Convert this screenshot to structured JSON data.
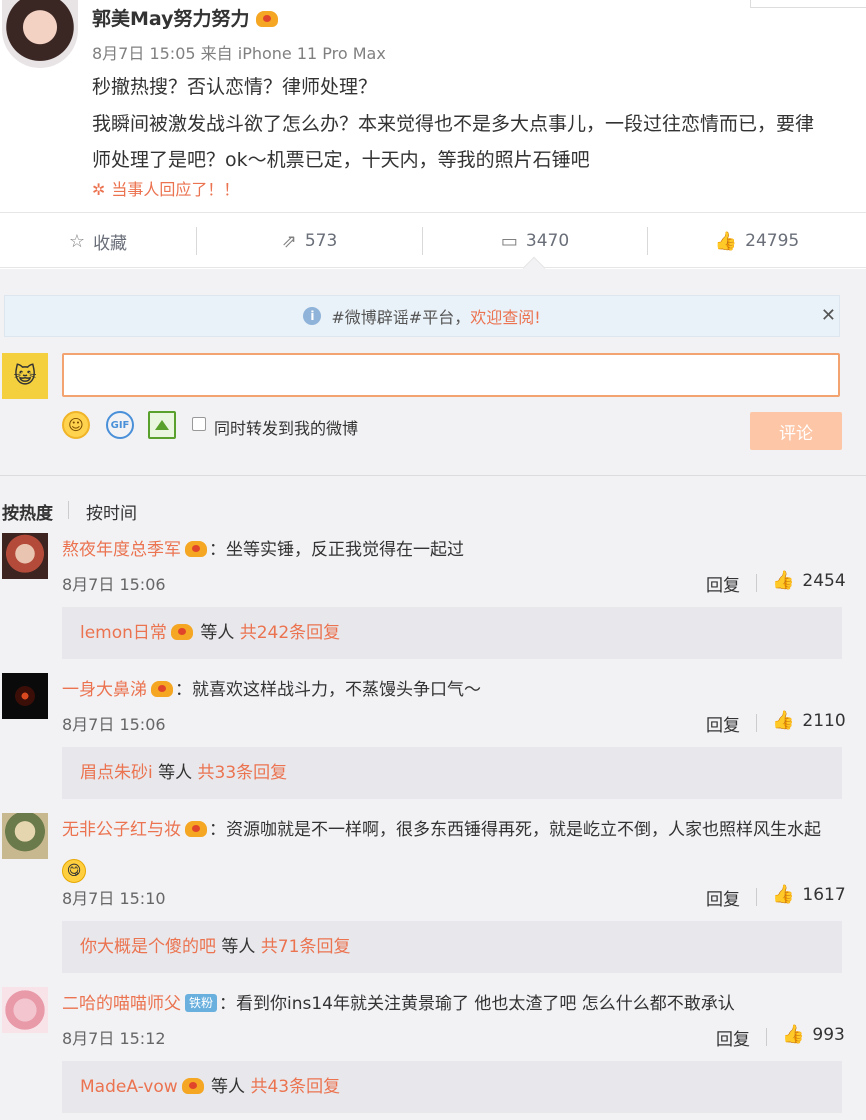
{
  "post": {
    "author": "郭美May努力努力",
    "date": "8月7日 15:05",
    "source": "来自 iPhone 11 Pro Max",
    "line1": "秒撤热搜？否认恋情？律师处理？",
    "line2": "我瞬间被激发战斗欲了怎么办？本来觉得也不是多大点事儿，一段过往恋情而已，要律师处理了是吧？ok～机票已定，十天内，等我的照片石锤吧",
    "topic": "当事人回应了！！"
  },
  "actions": {
    "favorite": "收藏",
    "repost": "573",
    "comments": "3470",
    "likes": "24795"
  },
  "notice": {
    "text": "#微博辟谣#平台，",
    "link": "欢迎查阅!"
  },
  "composer": {
    "input_value": "",
    "repost_label": "同时转发到我的微博",
    "submit": "评论",
    "gif": "GIF"
  },
  "sort": {
    "hot": "按热度",
    "time": "按时间"
  },
  "comments": [
    {
      "user": "熬夜年度总季军",
      "text": "：坐等实锤，反正我觉得在一起过",
      "time": "8月7日 15:06",
      "reply": "回复",
      "likes": "2454",
      "sub_user": "lemon日常",
      "sub_mid": "等人",
      "sub_total": "共242条回复"
    },
    {
      "user": "一身大鼻涕",
      "text": "：就喜欢这样战斗力，不蒸馒头争口气～",
      "time": "8月7日 15:06",
      "reply": "回复",
      "likes": "2110",
      "sub_user": "眉点朱砂i",
      "sub_mid": "等人",
      "sub_total": "共33条回复"
    },
    {
      "user": "无非公子红与妆",
      "text": "：资源咖就是不一样啊，很多东西锤得再死，就是屹立不倒，人家也照样风生水起",
      "time": "8月7日 15:10",
      "reply": "回复",
      "likes": "1617",
      "sub_user": "你大概是个傻的吧",
      "sub_mid": "等人",
      "sub_total": "共71条回复"
    },
    {
      "user": "二哈的喵喵师父",
      "fan_badge": "铁粉",
      "text": "：看到你ins14年就关注黄景瑜了 他也太渣了吧 怎么什么都不敢承认",
      "time": "8月7日 15:12",
      "reply": "回复",
      "likes": "993",
      "sub_user": "MadeA-vow",
      "sub_mid": "等人",
      "sub_total": "共43条回复"
    }
  ],
  "colors": {
    "accent": "#eb7350",
    "submit_disabled": "#fdc6a6",
    "comment_bg": "#f2f2f5"
  }
}
